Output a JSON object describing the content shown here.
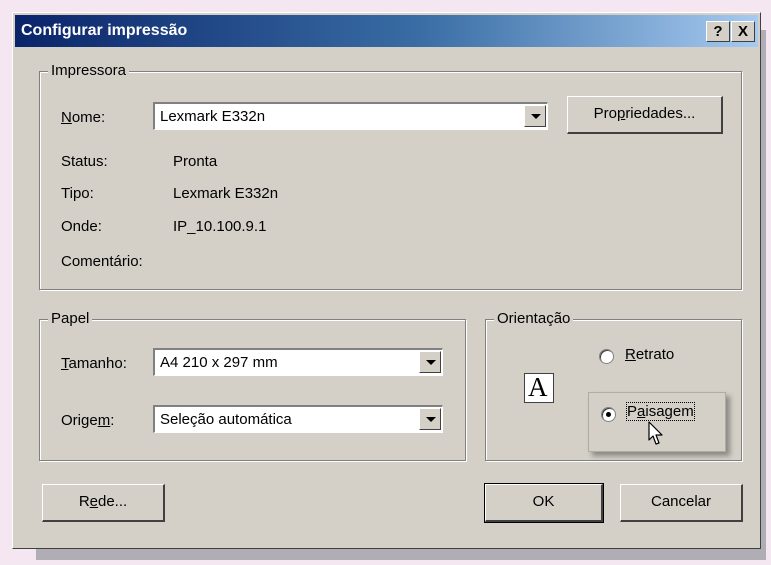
{
  "dialog": {
    "title": "Configurar impressão",
    "help_label": "?",
    "close_label": "X"
  },
  "printer": {
    "legend": "Impressora",
    "name_label_underlined": "N",
    "name_label_rest": "ome:",
    "name_value": "Lexmark E332n",
    "properties_pre": "Pro",
    "properties_u": "p",
    "properties_post": "riedades...",
    "status_label": "Status:",
    "status_value": "Pronta",
    "type_label": "Tipo:",
    "type_value": "Lexmark E332n",
    "where_label": "Onde:",
    "where_value": "IP_10.100.9.1",
    "comment_label": "Comentário:"
  },
  "paper": {
    "legend": "Papel",
    "size_label_underlined": "T",
    "size_label_rest": "amanho:",
    "size_value": "A4 210 x 297 mm",
    "source_label_pre": "Orige",
    "source_label_u": "m",
    "source_label_post": ":",
    "source_value": "Seleção automática"
  },
  "orientation": {
    "legend": "Orientação",
    "icon_glyph": "A",
    "portrait_underlined": "R",
    "portrait_rest": "etrato",
    "landscape_pre": "P",
    "landscape_u": "a",
    "landscape_post": "isagem",
    "selected": "Paisagem"
  },
  "buttons": {
    "network_pre": "R",
    "network_u": "e",
    "network_post": "de...",
    "ok": "OK",
    "cancel": "Cancelar"
  }
}
